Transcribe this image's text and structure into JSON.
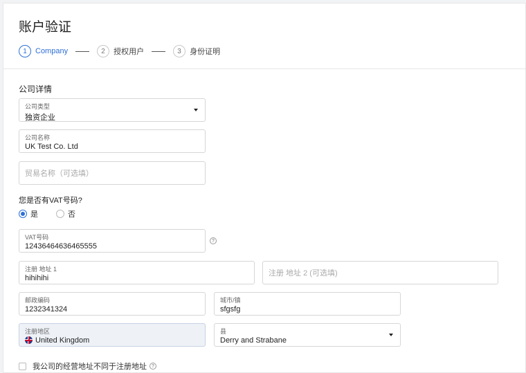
{
  "page": {
    "title": "账户验证"
  },
  "stepper": {
    "steps": [
      {
        "num": "1",
        "label": "Company"
      },
      {
        "num": "2",
        "label": "授权用户"
      },
      {
        "num": "3",
        "label": "身份证明"
      }
    ]
  },
  "form": {
    "section_title": "公司详情",
    "company_type": {
      "label": "公司类型",
      "value": "独资企业"
    },
    "company_name": {
      "label": "公司名称",
      "value": "UK Test Co. Ltd"
    },
    "trade_name": {
      "placeholder": "贸易名称（可选填）"
    },
    "vat_question": "您是否有VAT号码?",
    "vat_options": {
      "yes": "是",
      "no": "否"
    },
    "vat_number": {
      "label": "VAT号码",
      "value": "12436464636465555"
    },
    "address1": {
      "label": "注册 地址 1",
      "value": "hihihihi"
    },
    "address2": {
      "placeholder": "注册 地址 2 (可选填)"
    },
    "postcode": {
      "label": "邮政编码",
      "value": "1232341324"
    },
    "city": {
      "label": "城市/镇",
      "value": "sfgsfg"
    },
    "region": {
      "label": "注册地区",
      "value": "United Kingdom"
    },
    "county": {
      "label": "县",
      "value": "Derry and Strabane"
    },
    "different_address": {
      "label": "我公司的经营地址不同于注册地址"
    }
  },
  "icons": {
    "help": "question-circle-icon",
    "caret": "caret-down-icon",
    "flag": "uk-flag-icon"
  },
  "colors": {
    "accent": "#2d6fd6"
  }
}
